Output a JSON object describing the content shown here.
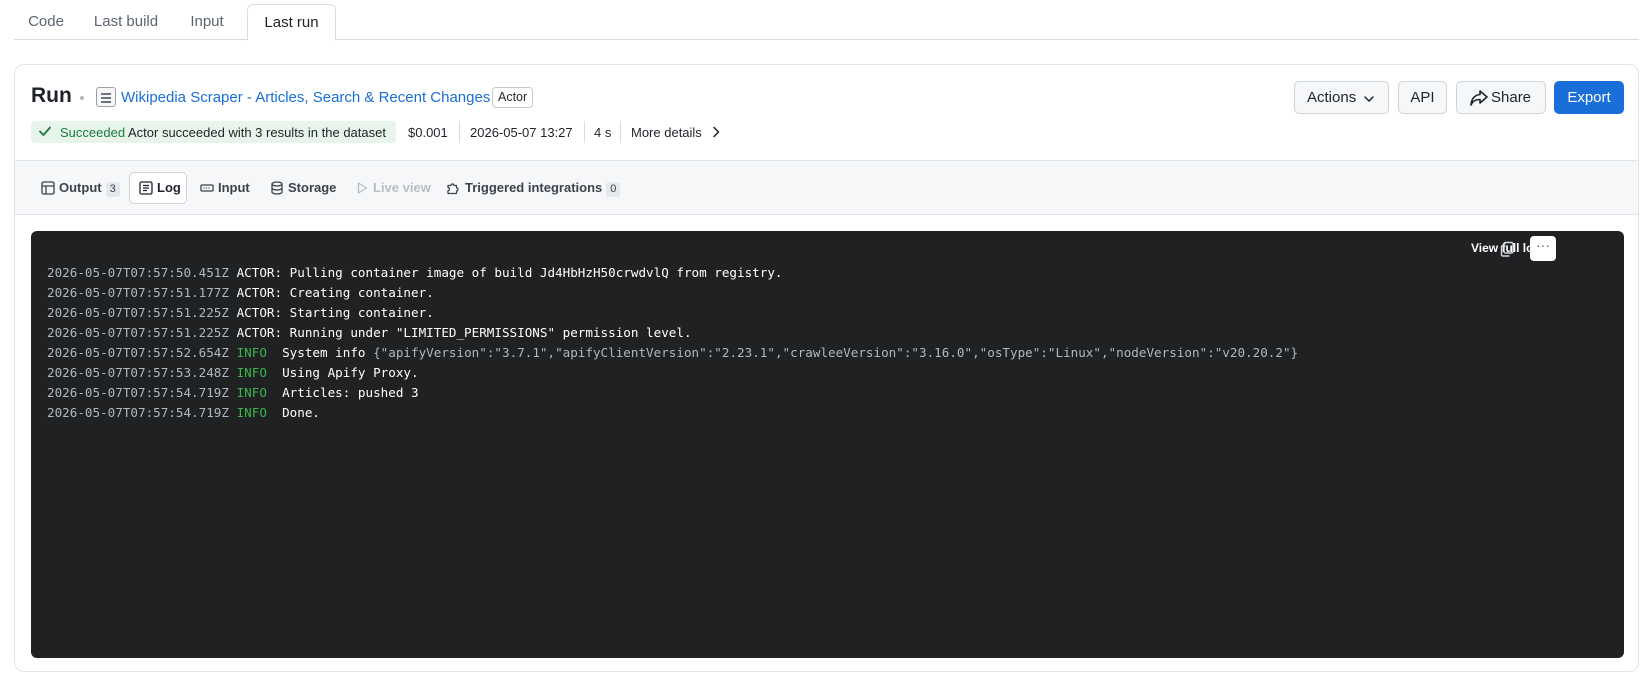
{
  "top_tabs": [
    {
      "label": "Code"
    },
    {
      "label": "Last build"
    },
    {
      "label": "Input"
    },
    {
      "label": "Last run"
    }
  ],
  "header": {
    "title": "Run",
    "actor_name": "Wikipedia Scraper - Articles, Search & Recent Changes",
    "actor_tag": "Actor",
    "actions_label": "Actions",
    "api_label": "API",
    "share_label": "Share",
    "export_label": "Export"
  },
  "status": {
    "state": "Succeeded",
    "message": "Actor succeeded with 3 results in the dataset",
    "cost": "$0.001",
    "started": "2026-05-07 13:27",
    "duration": "4 s",
    "more_details": "More details"
  },
  "subtabs": [
    {
      "label": "Output",
      "count": "3"
    },
    {
      "label": "Log"
    },
    {
      "label": "Input"
    },
    {
      "label": "Storage"
    },
    {
      "label": "Live view"
    },
    {
      "label": "Triggered integrations",
      "count": "0"
    }
  ],
  "log": {
    "view_full_log": "View full log",
    "more_glyph": "···",
    "lines": [
      {
        "ts": "2026-05-07T07:57:50.451Z",
        "src": "ACTOR:",
        "level": "",
        "msg": "Pulling container image of build Jd4HbHzH50crwdvlQ from registry.",
        "extra": ""
      },
      {
        "ts": "2026-05-07T07:57:51.177Z",
        "src": "ACTOR:",
        "level": "",
        "msg": "Creating container.",
        "extra": ""
      },
      {
        "ts": "2026-05-07T07:57:51.225Z",
        "src": "ACTOR:",
        "level": "",
        "msg": "Starting container.",
        "extra": ""
      },
      {
        "ts": "2026-05-07T07:57:51.225Z",
        "src": "ACTOR:",
        "level": "",
        "msg": "Running under \"LIMITED_PERMISSIONS\" permission level.",
        "extra": ""
      },
      {
        "ts": "2026-05-07T07:57:52.654Z",
        "src": "",
        "level": "INFO",
        "msg": "System info",
        "extra": "{\"apifyVersion\":\"3.7.1\",\"apifyClientVersion\":\"2.23.1\",\"crawleeVersion\":\"3.16.0\",\"osType\":\"Linux\",\"nodeVersion\":\"v20.20.2\"}"
      },
      {
        "ts": "2026-05-07T07:57:53.248Z",
        "src": "",
        "level": "INFO",
        "msg": "Using Apify Proxy.",
        "extra": ""
      },
      {
        "ts": "2026-05-07T07:57:54.719Z",
        "src": "",
        "level": "INFO",
        "msg": "Articles: pushed 3",
        "extra": ""
      },
      {
        "ts": "2026-05-07T07:57:54.719Z",
        "src": "",
        "level": "INFO",
        "msg": "Done.",
        "extra": ""
      }
    ]
  }
}
